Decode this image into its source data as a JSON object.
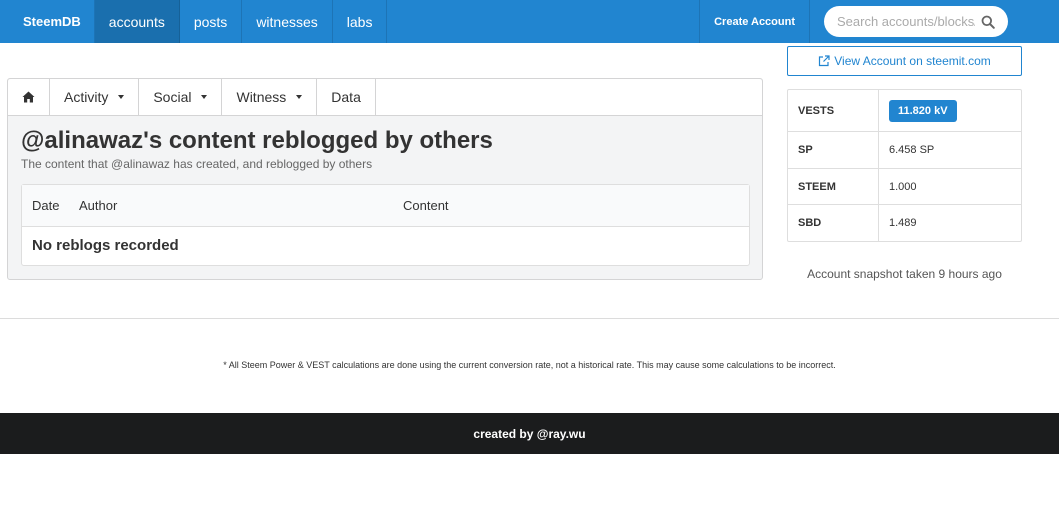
{
  "navbar": {
    "brand": "SteemDB",
    "items": [
      {
        "label": "accounts",
        "active": true
      },
      {
        "label": "posts",
        "active": false
      },
      {
        "label": "witnesses",
        "active": false
      },
      {
        "label": "labs",
        "active": false
      }
    ],
    "create_account": "Create Account",
    "search_placeholder": "Search accounts/blocks/tx",
    "search_icon": "search-icon"
  },
  "tabs": {
    "home_icon": "home-icon",
    "items": [
      "Activity",
      "Social",
      "Witness",
      "Data"
    ]
  },
  "main": {
    "title": "@alinawaz's content reblogged by others",
    "subtitle": "The content that @alinawaz has created, and reblogged by others",
    "table": {
      "columns": [
        "Date",
        "Author",
        "Content"
      ],
      "empty_message": "No reblogs recorded"
    }
  },
  "sidebar": {
    "view_account_label": "View Account on steemit.com",
    "stats": [
      {
        "key": "VESTS",
        "value": "11.820 kV"
      },
      {
        "key": "SP",
        "value": "6.458 SP"
      },
      {
        "key": "STEEM",
        "value": "1.000"
      },
      {
        "key": "SBD",
        "value": "1.489"
      }
    ],
    "snapshot": "Account snapshot taken 9 hours ago"
  },
  "footer": {
    "disclaimer": "* All Steem Power & VEST calculations are done using the current conversion rate, not a historical rate. This may cause some calculations to be incorrect.",
    "credit": "created by @ray.wu"
  },
  "colors": {
    "primary": "#2185d0",
    "primary_active": "#1a6fae",
    "footer_bg": "#1b1c1d"
  }
}
